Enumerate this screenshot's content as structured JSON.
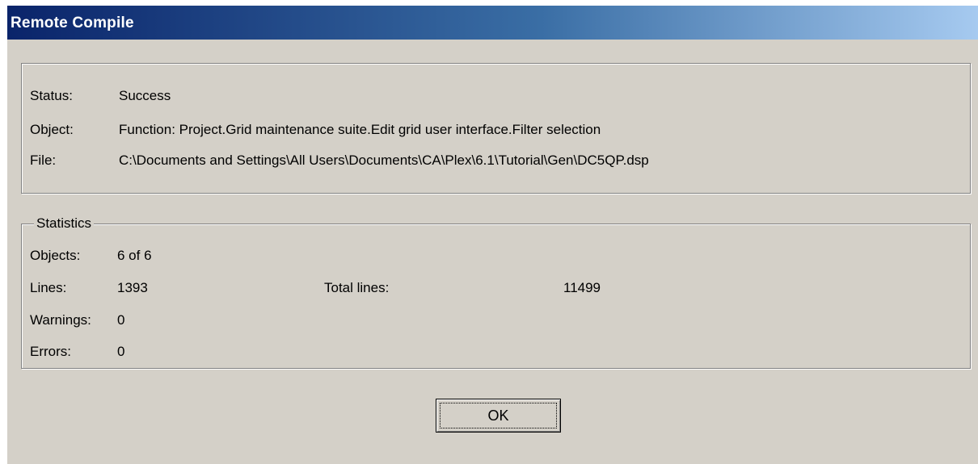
{
  "window": {
    "title": "Remote Compile"
  },
  "info": {
    "status_label": "Status:",
    "status_value": "Success",
    "object_label": "Object:",
    "object_value": "Function: Project.Grid maintenance suite.Edit grid user interface.Filter selection",
    "file_label": "File:",
    "file_value": "C:\\Documents and Settings\\All Users\\Documents\\CA\\Plex\\6.1\\Tutorial\\Gen\\DC5QP.dsp"
  },
  "statistics": {
    "title": "Statistics",
    "objects_label": "Objects:",
    "objects_value": "6 of 6",
    "lines_label": "Lines:",
    "lines_value": "1393",
    "total_lines_label": "Total lines:",
    "total_lines_value": "11499",
    "warnings_label": "Warnings:",
    "warnings_value": "0",
    "errors_label": "Errors:",
    "errors_value": "0"
  },
  "buttons": {
    "ok_label": "OK"
  }
}
